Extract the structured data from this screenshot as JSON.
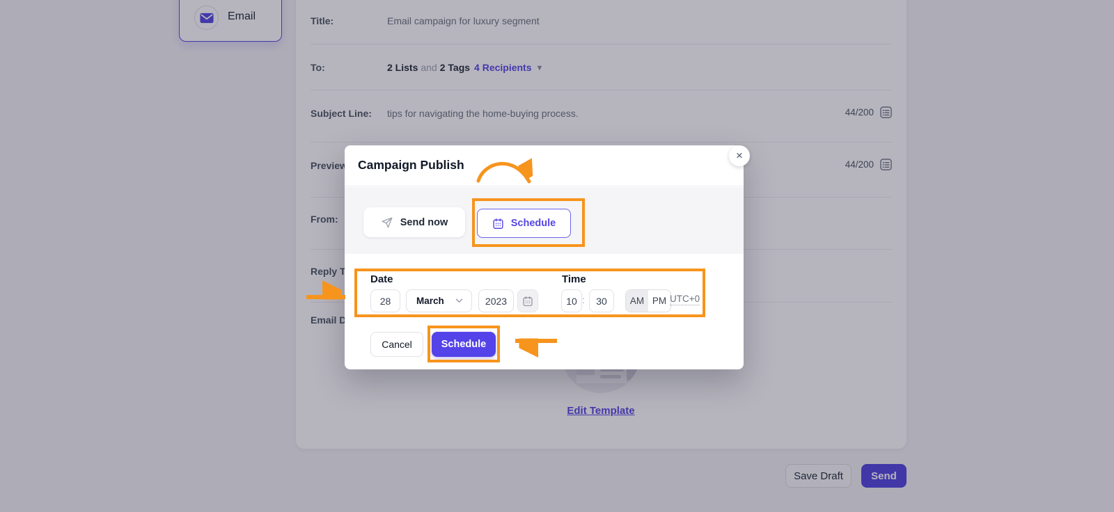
{
  "email_type": {
    "label": "Email"
  },
  "form": {
    "title_label": "Title:",
    "title_value": "Email campaign for luxury segment",
    "to_label": "To:",
    "to_lists": "2 Lists",
    "to_and": "and",
    "to_tags": "2 Tags",
    "to_recipients": "4 Recipients",
    "subject_label": "Subject Line:",
    "subject_value": "tips for navigating the home-buying process.",
    "subject_counter": "44/200",
    "preview_label": "Preview",
    "preview_counter": "44/200",
    "from_label": "From:",
    "reply_to_label": "Reply To",
    "email_design_label": "Email De"
  },
  "template_section": {
    "edit_link": "Edit Template"
  },
  "page_footer": {
    "save_draft": "Save Draft",
    "send": "Send"
  },
  "modal": {
    "title": "Campaign Publish",
    "close": "×",
    "send_now": "Send now",
    "schedule_tab": "Schedule",
    "date_label": "Date",
    "day_value": "28",
    "month_value": "March",
    "year_value": "2023",
    "time_label": "Time",
    "hour_value": "10",
    "minute_value": "30",
    "time_separator": ":",
    "am": "AM",
    "pm": "PM",
    "timezone": "UTC+0",
    "cancel": "Cancel",
    "schedule_submit": "Schedule"
  },
  "colors": {
    "accent": "#5646E5",
    "schedule_button": "#5443E8",
    "annotation_orange": "#F7941D",
    "overlay": "rgba(33,29,56,0.33)"
  }
}
